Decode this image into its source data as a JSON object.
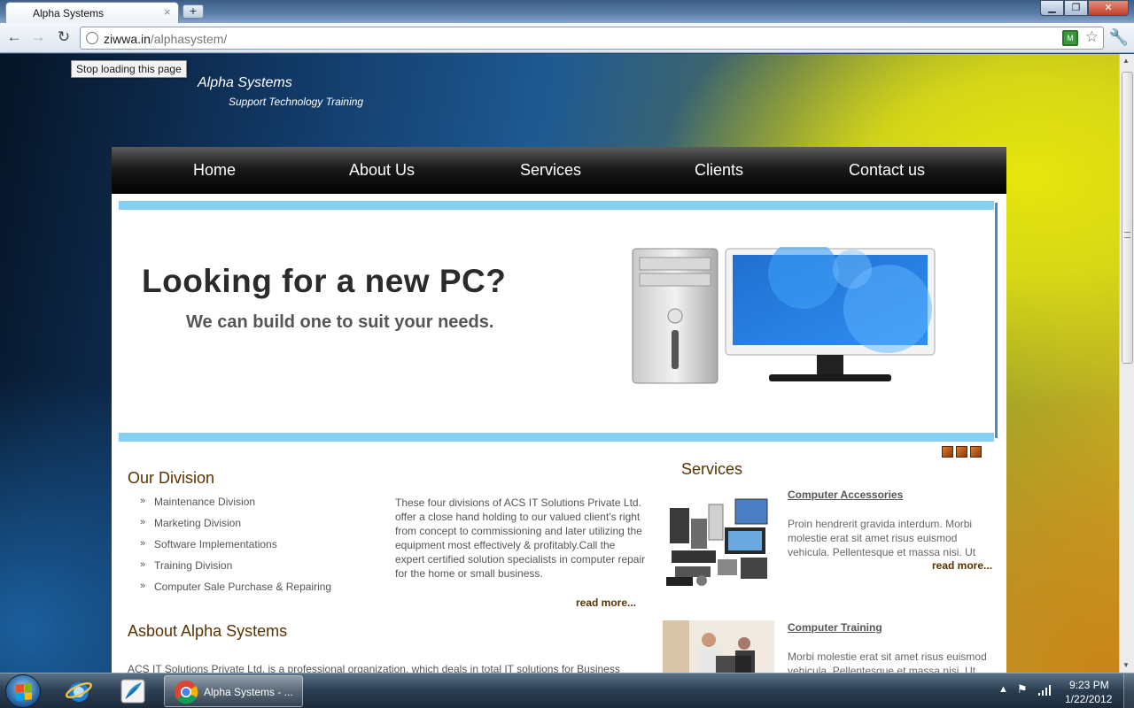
{
  "browser": {
    "tab_title": "Alpha Systems",
    "tab_close": "×",
    "new_tab": "+",
    "url_host": "ziwwa.in",
    "url_path": "/alphasystem/",
    "tooltip": "Stop loading this page",
    "window_buttons": {
      "minimize": "▁",
      "restore": "❐",
      "close": "✕"
    }
  },
  "site": {
    "brand": "Alpha Systems",
    "tagline": "Support Technology Training",
    "nav": [
      "Home",
      "About Us",
      "Services",
      "Clients",
      "Contact us"
    ],
    "banner": {
      "headline": "Looking for a new PC?",
      "subline": "We can build one to suit your needs."
    },
    "division": {
      "title": "Our Division",
      "items": [
        "Maintenance Division",
        "Marketing Division",
        "Software Implementations",
        "Training Division",
        "Computer Sale Purchase & Repairing"
      ],
      "description": "These four divisions of ACS IT Solutions Private Ltd. offer a close hand holding to our valued client's right from concept to commissioning and later utilizing the equipment most effectively & profitably.Call the expert certified solution specialists in computer repair for the home or small business.",
      "read_more": "read more..."
    },
    "about": {
      "title": "Asbout Alpha Systems",
      "text": "ACS IT Solutions Private Ltd. is a professional organization, which deals in total IT solutions for Business"
    },
    "services": {
      "title": "Services",
      "items": [
        {
          "name": "Computer Accessories",
          "text": "Proin hendrerit gravida interdum. Morbi molestie erat sit amet risus euismod vehicula. Pellentesque et massa nisi. Ut",
          "read_more": "read more..."
        },
        {
          "name": "Computer Training",
          "text": "Morbi molestie erat sit amet risus euismod vehicula. Pellentesque et massa nisi. Ut"
        }
      ]
    }
  },
  "taskbar": {
    "task_label": "Alpha Systems - ...",
    "time": "9:23 PM",
    "date": "1/22/2012"
  },
  "colors": {
    "nav_bg": "#000000",
    "banner_bar": "#85d0f2",
    "heading_brown": "#5a3200",
    "slider_dot": "#c8601e"
  }
}
